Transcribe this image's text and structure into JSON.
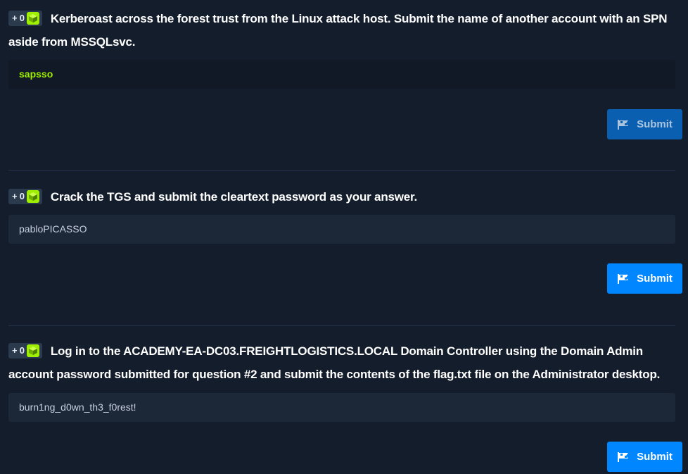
{
  "questions": [
    {
      "points": "+ 0",
      "text": "Kerberoast across the forest trust from the Linux attack host. Submit the name of another account with an SPN aside from MSSQLsvc.",
      "answer": "sapsso",
      "status": "correct",
      "submit_label": "Submit"
    },
    {
      "points": "+ 0",
      "text": "Crack the TGS and submit the cleartext password as your answer.",
      "answer": "pabloPICASSO",
      "status": "pending",
      "submit_label": "Submit"
    },
    {
      "points": "+ 0",
      "text": "Log in to the ACADEMY-EA-DC03.FREIGHTLOGISTICS.LOCAL Domain Controller using the Domain Admin account password submitted for question #2 and submit the contents of the flag.txt file on the Administrator desktop.",
      "answer": "burn1ng_d0wn_th3_f0rest!",
      "status": "pending",
      "submit_label": "Submit"
    }
  ],
  "colors": {
    "background": "#141d2b",
    "accent_green": "#9fef00",
    "submit_blue": "#0086ff"
  }
}
